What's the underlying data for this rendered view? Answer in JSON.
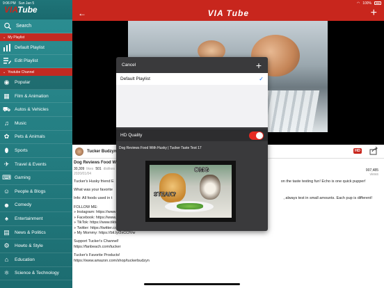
{
  "status_bar": {
    "time": "9:06 PM",
    "date": "Sun Jan 5",
    "battery": "100%"
  },
  "sidebar": {
    "logo_prefix": "VIA",
    "logo_suffix": "Tube",
    "search_label": "Search",
    "my_playlist_section": "My Playlist",
    "playlist_items": [
      {
        "label": "Default Playlist",
        "icon": "bar-chart-icon"
      },
      {
        "label": "Edit Playlist",
        "icon": "edit-list-icon"
      }
    ],
    "youtube_channel_section": "Youtube Channel",
    "channel_items": [
      {
        "label": "Popular",
        "icon": "popular-icon"
      },
      {
        "label": "Film & Animation",
        "icon": "film-icon"
      },
      {
        "label": "Autos & Vehicles",
        "icon": "car-icon"
      },
      {
        "label": "Music",
        "icon": "music-icon"
      },
      {
        "label": "Pets & Animals",
        "icon": "paw-icon"
      },
      {
        "label": "Sports",
        "icon": "football-icon"
      },
      {
        "label": "Travel & Events",
        "icon": "plane-icon"
      },
      {
        "label": "Gaming",
        "icon": "gamepad-icon"
      },
      {
        "label": "People & Blogs",
        "icon": "people-icon"
      },
      {
        "label": "Comedy",
        "icon": "comedy-icon"
      },
      {
        "label": "Entertainment",
        "icon": "masks-icon"
      },
      {
        "label": "News & Politics",
        "icon": "newspaper-icon"
      },
      {
        "label": "Howto & Style",
        "icon": "gears-icon"
      },
      {
        "label": "Education",
        "icon": "graduation-cap-icon"
      },
      {
        "label": "Science & Technology",
        "icon": "atom-icon"
      }
    ]
  },
  "header": {
    "logo": "VIA Tube",
    "back_icon": "back-arrow-icon",
    "add_icon": "plus-icon"
  },
  "video": {
    "channel": "Tucker Budzyn",
    "hd_badge": "HD",
    "title": "Dog Reviews Food With Husky | Tucker Taste Test 17",
    "title_truncated": "Dog Reviews Food W",
    "views": "30,309",
    "views_label": "likes",
    "dislikes": "501",
    "dislikes_label": "dislikes",
    "date": "2020/01/04",
    "total_views": "907,485",
    "total_views_label": "views",
    "description_lines": [
      "Tucker's Husky friend E",
      "on the taste testing fun! Echo is one quick pupper!",
      "What was your favorite",
      "Info: All foods used in t",
      ", always test in small amounts. Each pup is different!"
    ],
    "follow": "FOLLOW ME:\n» Instagram: https://www\n» Facebook: https://www.facebook.com/tuckerbudzyn\n» TikTok: https://www.tiktok.com/@tuckerbudzyn\n» Twitter: https://twitter.com/tuckerbudzyn\n» My Mommy: https://bit.ly/2xCCfVw",
    "support": "Support Tucker's Channel!\nhttps://fanbeach.com/tucker",
    "products": "Tucker's Favorite Products!\nhttps://www.amazon.com/shop/tuckerbudzyn"
  },
  "modal": {
    "cancel": "Cancel",
    "playlists": [
      {
        "label": "Default Playlist",
        "selected": true
      }
    ],
    "hd_quality_label": "HD Quality",
    "hd_quality_on": true,
    "video_title": "Dog Reviews Food With Husky | Tucker Taste Test 17",
    "thumb_text_1": "OMG",
    "thumb_text_2": "STEAK?"
  }
}
